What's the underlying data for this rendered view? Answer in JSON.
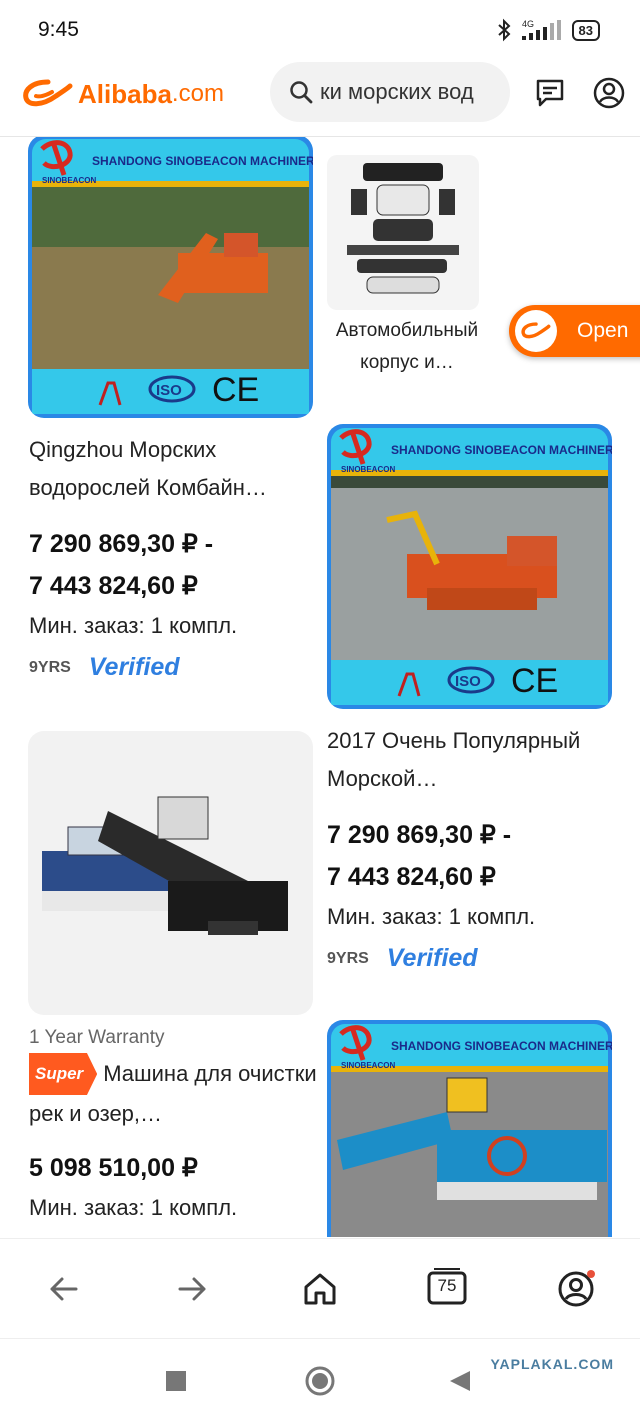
{
  "status_bar": {
    "time": "9:45",
    "network": "4G",
    "battery": "83"
  },
  "header": {
    "brand": "Alibaba",
    "brand_suffix": ".com",
    "search_query": "ки морских вод"
  },
  "cards": [
    {
      "image": {
        "banner": "SHANDONG SINOBEACON MACHINERY LTD",
        "sub": "SINOBEACON",
        "badge": "ISO",
        "mark": "CE"
      },
      "title": "Qingzhou Морских водорослей Комбайн…",
      "price_line1": "7 290 869,30 ₽ -",
      "price_line2": "7 443 824,60 ₽",
      "moq": "Мин. заказ: 1 компл.",
      "years": "9YRS",
      "verified": "Verified"
    },
    {
      "title": "Автомобильный корпус и…"
    },
    {
      "image": {
        "banner": "SHANDONG SINOBEACON MACHINERY LTD",
        "sub": "SINOBEACON",
        "badge": "ISO",
        "mark": "CE"
      },
      "title": "2017 Очень Популярный Морской…",
      "price_line1": "7 290 869,30 ₽ -",
      "price_line2": "7 443 824,60 ₽",
      "moq": "Мин. заказ: 1 компл.",
      "years": "9YRS",
      "verified": "Verified"
    },
    {
      "warranty": "1 Year Warranty",
      "super_badge": "Super",
      "title": "Машина для очистки рек и озер,…",
      "price": "5 098 510,00 ₽",
      "moq": "Мин. заказ: 1 компл."
    },
    {
      "image": {
        "banner": "SHANDONG SINOBEACON MACHINERY LTD",
        "sub": "SINOBEACON"
      }
    }
  ],
  "open_button": {
    "label": "Open"
  },
  "nav": {
    "tabs_count": "75"
  },
  "watermark": "YAPLAKAL.COM",
  "colors": {
    "accent": "#ff6a00",
    "verified": "#2f7fe0",
    "banner_cyan": "#34c8ea",
    "card_border": "#2a88e6"
  }
}
